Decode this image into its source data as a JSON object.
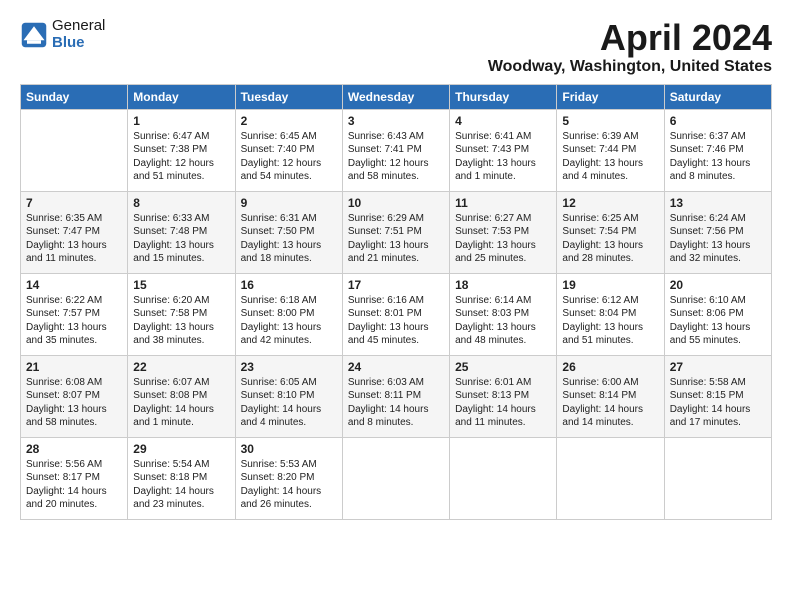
{
  "header": {
    "logo_general": "General",
    "logo_blue": "Blue",
    "month_title": "April 2024",
    "location": "Woodway, Washington, United States"
  },
  "days_of_week": [
    "Sunday",
    "Monday",
    "Tuesday",
    "Wednesday",
    "Thursday",
    "Friday",
    "Saturday"
  ],
  "weeks": [
    [
      {
        "day": "",
        "text": ""
      },
      {
        "day": "1",
        "text": "Sunrise: 6:47 AM\nSunset: 7:38 PM\nDaylight: 12 hours\nand 51 minutes."
      },
      {
        "day": "2",
        "text": "Sunrise: 6:45 AM\nSunset: 7:40 PM\nDaylight: 12 hours\nand 54 minutes."
      },
      {
        "day": "3",
        "text": "Sunrise: 6:43 AM\nSunset: 7:41 PM\nDaylight: 12 hours\nand 58 minutes."
      },
      {
        "day": "4",
        "text": "Sunrise: 6:41 AM\nSunset: 7:43 PM\nDaylight: 13 hours\nand 1 minute."
      },
      {
        "day": "5",
        "text": "Sunrise: 6:39 AM\nSunset: 7:44 PM\nDaylight: 13 hours\nand 4 minutes."
      },
      {
        "day": "6",
        "text": "Sunrise: 6:37 AM\nSunset: 7:46 PM\nDaylight: 13 hours\nand 8 minutes."
      }
    ],
    [
      {
        "day": "7",
        "text": "Sunrise: 6:35 AM\nSunset: 7:47 PM\nDaylight: 13 hours\nand 11 minutes."
      },
      {
        "day": "8",
        "text": "Sunrise: 6:33 AM\nSunset: 7:48 PM\nDaylight: 13 hours\nand 15 minutes."
      },
      {
        "day": "9",
        "text": "Sunrise: 6:31 AM\nSunset: 7:50 PM\nDaylight: 13 hours\nand 18 minutes."
      },
      {
        "day": "10",
        "text": "Sunrise: 6:29 AM\nSunset: 7:51 PM\nDaylight: 13 hours\nand 21 minutes."
      },
      {
        "day": "11",
        "text": "Sunrise: 6:27 AM\nSunset: 7:53 PM\nDaylight: 13 hours\nand 25 minutes."
      },
      {
        "day": "12",
        "text": "Sunrise: 6:25 AM\nSunset: 7:54 PM\nDaylight: 13 hours\nand 28 minutes."
      },
      {
        "day": "13",
        "text": "Sunrise: 6:24 AM\nSunset: 7:56 PM\nDaylight: 13 hours\nand 32 minutes."
      }
    ],
    [
      {
        "day": "14",
        "text": "Sunrise: 6:22 AM\nSunset: 7:57 PM\nDaylight: 13 hours\nand 35 minutes."
      },
      {
        "day": "15",
        "text": "Sunrise: 6:20 AM\nSunset: 7:58 PM\nDaylight: 13 hours\nand 38 minutes."
      },
      {
        "day": "16",
        "text": "Sunrise: 6:18 AM\nSunset: 8:00 PM\nDaylight: 13 hours\nand 42 minutes."
      },
      {
        "day": "17",
        "text": "Sunrise: 6:16 AM\nSunset: 8:01 PM\nDaylight: 13 hours\nand 45 minutes."
      },
      {
        "day": "18",
        "text": "Sunrise: 6:14 AM\nSunset: 8:03 PM\nDaylight: 13 hours\nand 48 minutes."
      },
      {
        "day": "19",
        "text": "Sunrise: 6:12 AM\nSunset: 8:04 PM\nDaylight: 13 hours\nand 51 minutes."
      },
      {
        "day": "20",
        "text": "Sunrise: 6:10 AM\nSunset: 8:06 PM\nDaylight: 13 hours\nand 55 minutes."
      }
    ],
    [
      {
        "day": "21",
        "text": "Sunrise: 6:08 AM\nSunset: 8:07 PM\nDaylight: 13 hours\nand 58 minutes."
      },
      {
        "day": "22",
        "text": "Sunrise: 6:07 AM\nSunset: 8:08 PM\nDaylight: 14 hours\nand 1 minute."
      },
      {
        "day": "23",
        "text": "Sunrise: 6:05 AM\nSunset: 8:10 PM\nDaylight: 14 hours\nand 4 minutes."
      },
      {
        "day": "24",
        "text": "Sunrise: 6:03 AM\nSunset: 8:11 PM\nDaylight: 14 hours\nand 8 minutes."
      },
      {
        "day": "25",
        "text": "Sunrise: 6:01 AM\nSunset: 8:13 PM\nDaylight: 14 hours\nand 11 minutes."
      },
      {
        "day": "26",
        "text": "Sunrise: 6:00 AM\nSunset: 8:14 PM\nDaylight: 14 hours\nand 14 minutes."
      },
      {
        "day": "27",
        "text": "Sunrise: 5:58 AM\nSunset: 8:15 PM\nDaylight: 14 hours\nand 17 minutes."
      }
    ],
    [
      {
        "day": "28",
        "text": "Sunrise: 5:56 AM\nSunset: 8:17 PM\nDaylight: 14 hours\nand 20 minutes."
      },
      {
        "day": "29",
        "text": "Sunrise: 5:54 AM\nSunset: 8:18 PM\nDaylight: 14 hours\nand 23 minutes."
      },
      {
        "day": "30",
        "text": "Sunrise: 5:53 AM\nSunset: 8:20 PM\nDaylight: 14 hours\nand 26 minutes."
      },
      {
        "day": "",
        "text": ""
      },
      {
        "day": "",
        "text": ""
      },
      {
        "day": "",
        "text": ""
      },
      {
        "day": "",
        "text": ""
      }
    ]
  ]
}
